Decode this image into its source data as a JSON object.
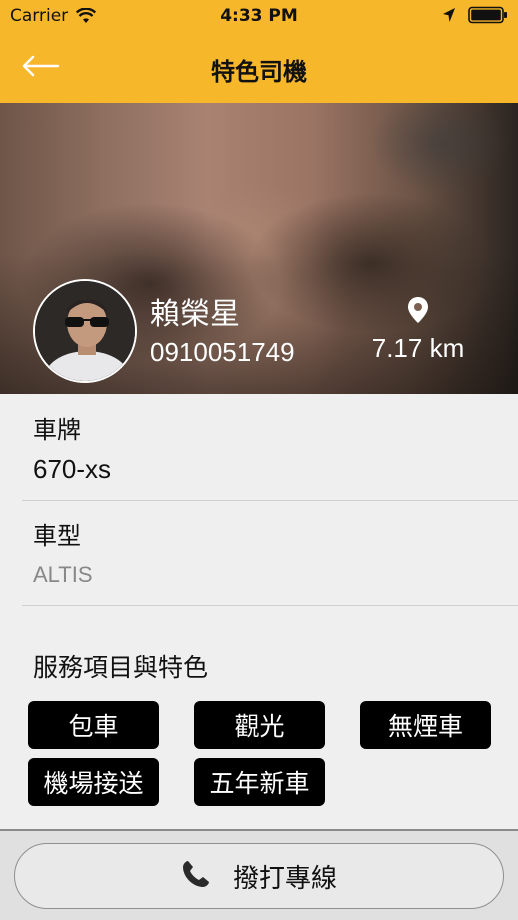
{
  "status_bar": {
    "carrier": "Carrier",
    "time": "4:33 PM"
  },
  "nav": {
    "title": "特色司機",
    "back_icon": "arrow-left-icon"
  },
  "driver": {
    "name": "賴榮星",
    "phone": "0910051749",
    "distance": "7.17 km"
  },
  "details": {
    "plate_label": "車牌",
    "plate_value": "670-xs",
    "model_label": "車型",
    "model_value": "ALTIS"
  },
  "services": {
    "title": "服務項目與特色",
    "tags": [
      "包車",
      "觀光",
      "無煙車",
      "機場接送",
      "五年新車"
    ]
  },
  "call_button": {
    "label": "撥打專線",
    "icon": "phone-icon"
  },
  "colors": {
    "header": "#f7b72a",
    "tag_bg": "#000000",
    "background": "#efefef"
  }
}
